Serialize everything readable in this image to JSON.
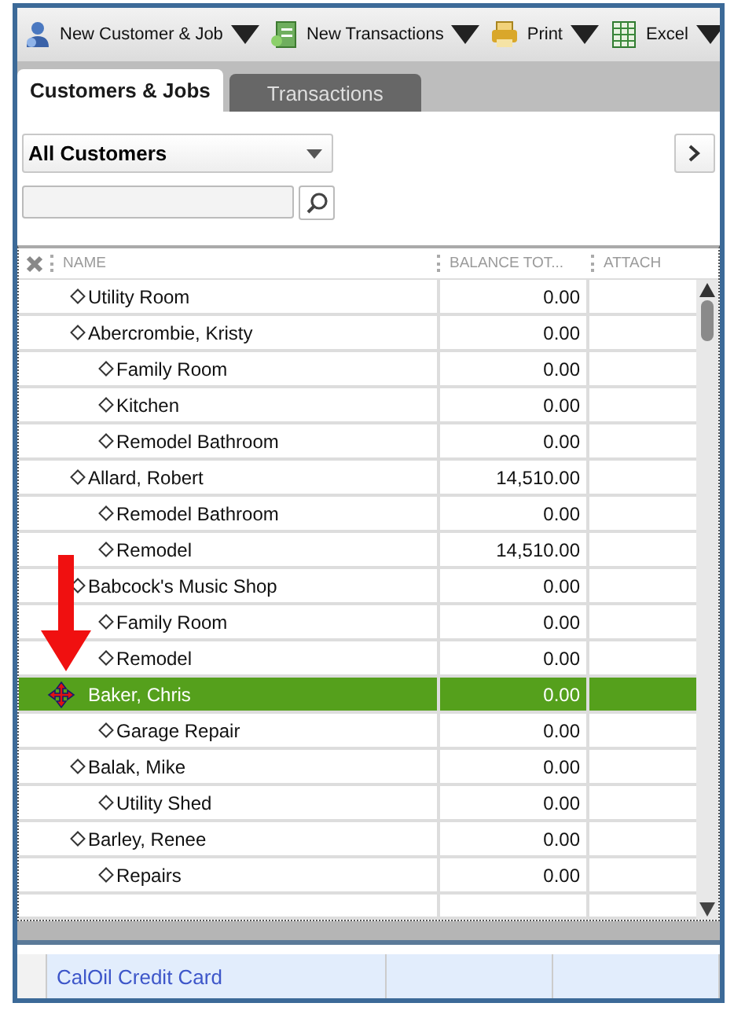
{
  "toolbar": [
    {
      "kind": "customer",
      "label": "New Customer & Job",
      "dropdown": true
    },
    {
      "kind": "transaction",
      "label": "New Transactions",
      "dropdown": true
    },
    {
      "kind": "print",
      "label": "Print",
      "dropdown": true
    },
    {
      "kind": "excel",
      "label": "Excel",
      "dropdown": true
    }
  ],
  "tabs": [
    {
      "label": "Customers & Jobs",
      "selected": true
    },
    {
      "label": "Transactions",
      "selected": false
    }
  ],
  "filter": {
    "value": "All Customers"
  },
  "columns": [
    "NAME",
    "BALANCE TOT...",
    "ATTACH"
  ],
  "customers": [
    {
      "name": "Utility Room",
      "balance": "0.00",
      "selected": false
    },
    {
      "name": "Abercrombie, Kristy",
      "balance": "0.00",
      "selected": false,
      "children": [
        {
          "name": "Family Room",
          "balance": "0.00",
          "selected": false
        },
        {
          "name": "Kitchen",
          "balance": "0.00",
          "selected": false
        },
        {
          "name": "Remodel Bathroom",
          "balance": "0.00",
          "selected": false
        }
      ]
    },
    {
      "name": "Allard, Robert",
      "balance": "14,510.00",
      "selected": false,
      "children": [
        {
          "name": "Remodel Bathroom",
          "balance": "0.00",
          "selected": false
        },
        {
          "name": "Remodel",
          "balance": "14,510.00",
          "selected": false
        }
      ]
    },
    {
      "name": "Babcock's Music Shop",
      "balance": "0.00",
      "selected": false,
      "children": [
        {
          "name": "Family Room",
          "balance": "0.00",
          "selected": false
        },
        {
          "name": "Remodel",
          "balance": "0.00",
          "selected": false
        }
      ]
    },
    {
      "name": "Baker, Chris",
      "balance": "0.00",
      "selected": true,
      "children": [
        {
          "name": "Garage Repair",
          "balance": "0.00",
          "selected": false
        }
      ]
    },
    {
      "name": "Balak, Mike",
      "balance": "0.00",
      "selected": false,
      "children": [
        {
          "name": "Utility Shed",
          "balance": "0.00",
          "selected": false
        }
      ]
    },
    {
      "name": "Barley, Renee",
      "balance": "0.00",
      "selected": false,
      "children": [
        {
          "name": "Repairs",
          "balance": "0.00",
          "selected": false
        }
      ]
    }
  ],
  "bottom_row": {
    "name": "CalOil Credit Card"
  }
}
